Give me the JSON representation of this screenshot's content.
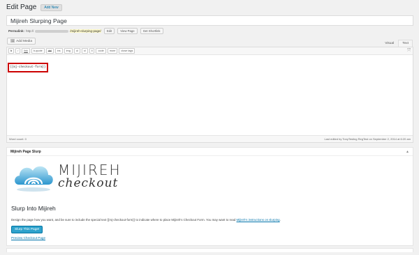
{
  "header": {
    "title": "Edit Page",
    "add_new": "Add New"
  },
  "post_title": "Mijireh Slurping Page",
  "permalink": {
    "label": "Permalink:",
    "prefix": "http://",
    "slug": "/mijireh-slurping-page/",
    "edit": "Edit",
    "view": "View Page",
    "shortlink": "Get Shortlink"
  },
  "add_media": "Add Media",
  "editor_tabs": [
    "Visual",
    "Text"
  ],
  "quicktags": [
    "b",
    "i",
    "link",
    "b-quote",
    "del",
    "ins",
    "img",
    "ul",
    "ol",
    "li",
    "code",
    "more",
    "close tags"
  ],
  "content": "{{mj-checkout-form}}",
  "statusbar": {
    "word_count": "Word count: 0",
    "last_edited": "Last edited by TonyTesting RegTest on September 2, 2014 at 6:20 am"
  },
  "metabox": {
    "title": "Mijireh Page Slurp",
    "logo_top": "MIJIREH",
    "logo_bottom": "checkout",
    "heading": "Slurp Into Mijireh",
    "desc_text": "Design the page how you want, and be sure to include the special text {{mj-checkout-form}} to indicate where to place Mijireh's Checkout Form. You may want to read ",
    "desc_link": "Mijireh's instructions on slurping",
    "desc_end": ".",
    "button": "Slurp This Page!",
    "preview": "Preview Checkout Page"
  },
  "colors": {
    "accent": "#2ea2cc",
    "highlight": "#cc0000",
    "link": "#0073aa"
  }
}
